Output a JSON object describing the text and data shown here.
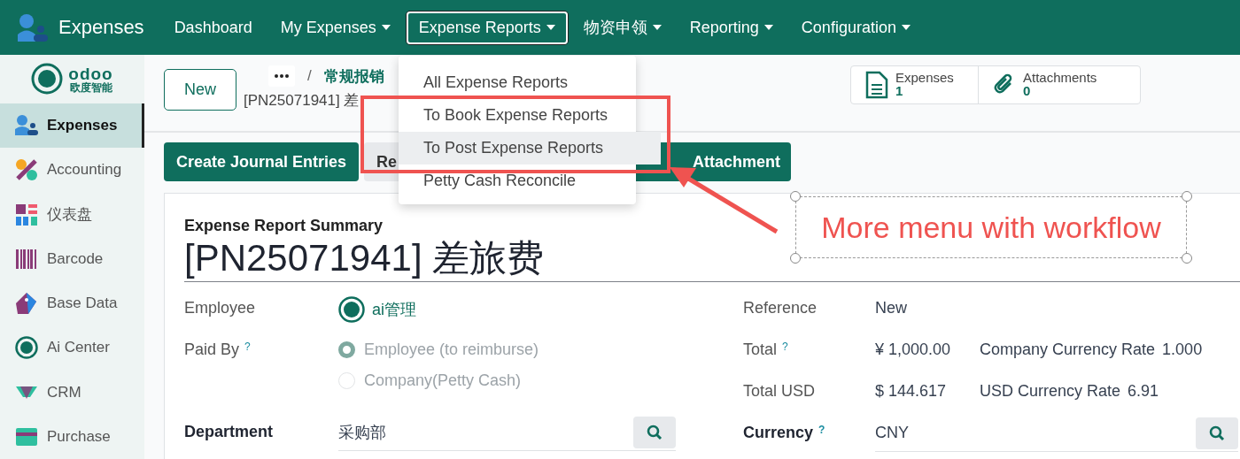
{
  "navbar": {
    "app_name": "Expenses",
    "items": [
      {
        "label": "Dashboard",
        "dropdown": false,
        "selected": false
      },
      {
        "label": "My Expenses",
        "dropdown": true,
        "selected": false
      },
      {
        "label": "Expense Reports",
        "dropdown": true,
        "selected": true
      },
      {
        "label": "物资申领",
        "dropdown": true,
        "selected": false
      },
      {
        "label": "Reporting",
        "dropdown": true,
        "selected": false
      },
      {
        "label": "Configuration",
        "dropdown": true,
        "selected": false
      }
    ]
  },
  "sidebar": {
    "logo": {
      "brand": "odoo",
      "subtitle": "欧度智能"
    },
    "items": [
      {
        "label": "Expenses",
        "selected": true
      },
      {
        "label": "Accounting",
        "selected": false
      },
      {
        "label": "仪表盘",
        "selected": false
      },
      {
        "label": "Barcode",
        "selected": false
      },
      {
        "label": "Base Data",
        "selected": false
      },
      {
        "label": "Ai Center",
        "selected": false
      },
      {
        "label": "CRM",
        "selected": false
      },
      {
        "label": "Purchase",
        "selected": false
      }
    ]
  },
  "control_panel": {
    "new_button": "New",
    "breadcrumb": {
      "separator": "/",
      "parent": "常规报销",
      "current": "[PN25071941] 差"
    },
    "stat_buttons": [
      {
        "label": "Expenses",
        "value": "1"
      },
      {
        "label": "Attachments",
        "value": "0"
      }
    ]
  },
  "action_buttons": [
    {
      "label": "Create Journal Entries",
      "kind": "primary"
    },
    {
      "label": "Re",
      "kind": "secondary"
    },
    {
      "label": "Attachment",
      "kind": "primary"
    }
  ],
  "dropdown_menu": {
    "items": [
      {
        "label": "All Expense Reports",
        "selected": false
      },
      {
        "label": "To Book Expense Reports",
        "selected": false
      },
      {
        "label": "To Post Expense Reports",
        "selected": true
      },
      {
        "label": "Petty Cash Reconcile",
        "selected": false
      }
    ]
  },
  "form": {
    "caption": "Expense Report Summary",
    "title": "[PN25071941] 差旅费",
    "left_fields": [
      {
        "label": "Employee",
        "kind": "avatar",
        "required": false,
        "value": "ai管理"
      },
      {
        "label": "Paid By",
        "kind": "radio",
        "required": false,
        "help": "?",
        "options": [
          {
            "label": "Employee (to reimburse)",
            "selected": true
          },
          {
            "label": "Company(Petty Cash)",
            "selected": false
          }
        ]
      },
      {
        "label": "Department",
        "kind": "many2one",
        "required": true,
        "value": "采购部"
      }
    ],
    "right_fields": [
      {
        "label": "Reference",
        "kind": "text",
        "required": false,
        "value": "New"
      },
      {
        "label": "Total",
        "kind": "rate",
        "required": false,
        "help": "?",
        "value": "¥ 1,000.00",
        "rate_label": "Company Currency Rate",
        "rate_value": "1.000"
      },
      {
        "label": "Total USD",
        "kind": "rate",
        "required": false,
        "value": "$ 144.617",
        "rate_label": "USD Currency Rate",
        "rate_value": "6.91"
      },
      {
        "label": "Currency",
        "kind": "many2one",
        "required": true,
        "help": "?",
        "value": "CNY"
      }
    ]
  },
  "annotation": {
    "text": "More menu with workflow"
  }
}
